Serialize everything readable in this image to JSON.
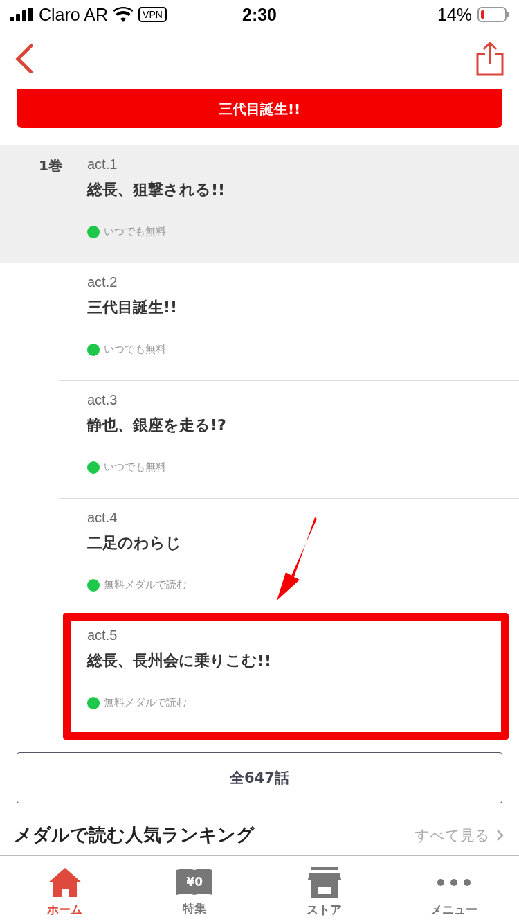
{
  "status_bar": {
    "carrier": "Claro AR",
    "vpn": "VPN",
    "time": "2:30",
    "battery": "14%"
  },
  "banner": {
    "label": "三代目誕生!!"
  },
  "episodes": [
    {
      "volume": "1巻",
      "number": "act.1",
      "title": "総長、狙撃される!!",
      "price": "いつでも無料",
      "color": "#1ec84a",
      "selected": true,
      "annotated": false
    },
    {
      "number": "act.2",
      "title": "三代目誕生!!",
      "price": "いつでも無料",
      "color": "#1ec84a",
      "selected": false,
      "annotated": false
    },
    {
      "number": "act.3",
      "title": "静也、銀座を走る!?",
      "price": "いつでも無料",
      "color": "#1ec84a",
      "selected": false,
      "annotated": false
    },
    {
      "number": "act.4",
      "title": "二足のわらじ",
      "price": "無料メダルで読む",
      "color": "#1ec84a",
      "selected": false,
      "annotated": false
    },
    {
      "number": "act.5",
      "title": "総長、長州会に乗りこむ!!",
      "price": "無料メダルで読む",
      "color": "#1ec84a",
      "selected": false,
      "annotated": true
    }
  ],
  "all_button": {
    "label": "全647話"
  },
  "ranking": {
    "title": "メダルで読む人気ランキング",
    "link": "すべて見る"
  },
  "tab_bar": [
    {
      "kind": "home",
      "label": "ホーム",
      "selected": true
    },
    {
      "kind": "book",
      "label": "特集",
      "badge": "¥0",
      "selected": false
    },
    {
      "kind": "store",
      "label": "ストア",
      "selected": false
    },
    {
      "kind": "more",
      "label": "メニュー",
      "selected": false
    }
  ]
}
